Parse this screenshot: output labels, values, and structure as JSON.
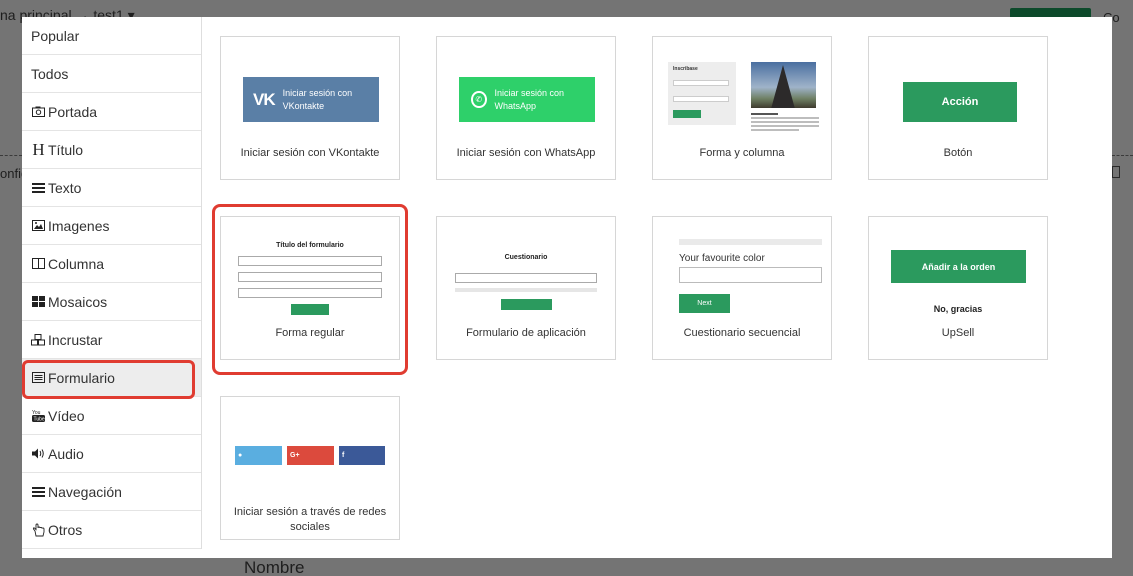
{
  "background": {
    "breadcrumb": "na principal → test1 ▾",
    "top_right": "Co",
    "left_label": "onfig",
    "below_field": "Nombre"
  },
  "sidebar": {
    "items": [
      {
        "label": "Popular",
        "icon": ""
      },
      {
        "label": "Todos",
        "icon": ""
      },
      {
        "label": "Portada",
        "icon": "camera-icon"
      },
      {
        "label": "Título",
        "icon": "heading-icon"
      },
      {
        "label": "Texto",
        "icon": "text-lines-icon"
      },
      {
        "label": "Imagenes",
        "icon": "image-icon"
      },
      {
        "label": "Columna",
        "icon": "columns-icon"
      },
      {
        "label": "Mosaicos",
        "icon": "tiles-icon"
      },
      {
        "label": "Incrustar",
        "icon": "cubes-icon"
      },
      {
        "label": "Formulario",
        "icon": "form-icon"
      },
      {
        "label": "Vídeo",
        "icon": "youtube-icon"
      },
      {
        "label": "Audio",
        "icon": "volume-icon"
      },
      {
        "label": "Navegación",
        "icon": "menu-icon"
      },
      {
        "label": "Otros",
        "icon": "hand-icon"
      }
    ],
    "active": "Formulario"
  },
  "cards": [
    {
      "title": "Iniciar sesión con VKontakte",
      "thumb": {
        "text": "Iniciar sesión con VKontakte",
        "logo": "VK"
      }
    },
    {
      "title": "Iniciar sesión con WhatsApp",
      "thumb": {
        "text": "Iniciar sesión con WhatsApp"
      }
    },
    {
      "title": "Forma y columna",
      "thumb": {
        "form_title": "Inscribase",
        "side_title": "Sobre la torre"
      }
    },
    {
      "title": "Botón",
      "thumb": {
        "button": "Acción"
      }
    },
    {
      "title": "Forma regular",
      "thumb": {
        "form_title": "Título del formulario"
      }
    },
    {
      "title": "Formulario de aplicación",
      "thumb": {
        "form_title": "Cuestionario"
      }
    },
    {
      "title": "Cuestionario secuencial",
      "thumb": {
        "question": "Your favourite color",
        "button": "Next"
      }
    },
    {
      "title": "UpSell",
      "thumb": {
        "button": "Añadir a la orden",
        "decline": "No, gracias"
      }
    },
    {
      "title": "Iniciar sesión a través de redes sociales",
      "thumb": {}
    }
  ],
  "colors": {
    "accent_green": "#2b9a5e",
    "highlight_red": "#e03c31",
    "vk_blue": "#5a7fa6",
    "whatsapp_green": "#2ed06a"
  }
}
